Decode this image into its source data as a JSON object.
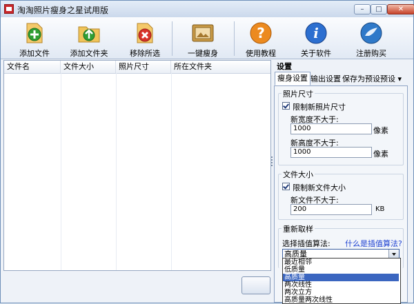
{
  "window": {
    "title": "淘淘照片瘦身之星试用版"
  },
  "toolbar": {
    "add_file": "添加文件",
    "add_folder": "添加文件夹",
    "remove_selected": "移除所选",
    "one_click_slim": "一键瘦身",
    "tutorial": "使用教程",
    "about": "关于软件",
    "register": "注册购买"
  },
  "file_table": {
    "columns": [
      "文件名",
      "文件大小",
      "照片尺寸",
      "所在文件夹"
    ]
  },
  "settings": {
    "header": "设置",
    "tabs": [
      "瘦身设置",
      "输出设置",
      "保存为预设",
      "预设 ▾"
    ],
    "photo_size": {
      "title": "照片尺寸",
      "limit_label": "限制新照片尺寸",
      "limit_checked": true,
      "width_label": "新宽度不大于:",
      "width_value": "1000",
      "height_label": "新高度不大于:",
      "height_value": "1000",
      "unit": "像素"
    },
    "file_size": {
      "title": "文件大小",
      "limit_label": "限制新文件大小",
      "limit_checked": true,
      "size_label": "新文件不大于:",
      "size_value": "200",
      "unit": "KB"
    },
    "resample": {
      "title": "重新取样",
      "algo_label": "选择插值算法:",
      "help_link": "什么是插值算法?",
      "selected": "高质量",
      "options": [
        "最近相邻",
        "低质量",
        "高质量",
        "两次线性",
        "两次立方",
        "高质量两次线性"
      ],
      "highlighted_index": 2
    }
  },
  "colors": {
    "accent": "#3b66c0",
    "link": "#1b3fd1"
  }
}
